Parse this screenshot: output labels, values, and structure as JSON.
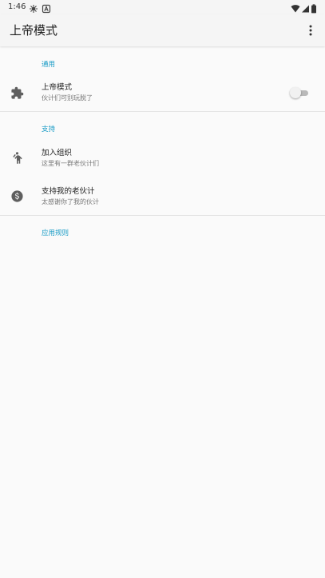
{
  "status_bar": {
    "time": "1:46",
    "left_icons": [
      "debug-icon",
      "notification-a-icon"
    ],
    "right_icons": [
      "wifi-icon",
      "cell-signal-icon",
      "battery-icon"
    ]
  },
  "app_bar": {
    "title": "上帝模式",
    "overflow_icon": "more-vert-icon"
  },
  "sections": [
    {
      "header": "通用",
      "items": [
        {
          "icon": "puzzle-icon",
          "title": "上帝模式",
          "summary": "伙计们可别玩脱了",
          "toggle": false
        }
      ]
    },
    {
      "header": "支持",
      "items": [
        {
          "icon": "person-icon",
          "title": "加入组织",
          "summary": "这里有一群老伙计们"
        },
        {
          "icon": "dollar-icon",
          "title": "支持我的老伙计",
          "summary": "太感谢你了我的伙计"
        }
      ]
    },
    {
      "header": "应用规则",
      "items": []
    }
  ],
  "colors": {
    "accent": "#1a9cc6",
    "background": "#fafafa",
    "toolbar": "#f5f5f5",
    "switch_off_track": "#b9b9b9",
    "switch_off_thumb": "#f1f1f1"
  }
}
